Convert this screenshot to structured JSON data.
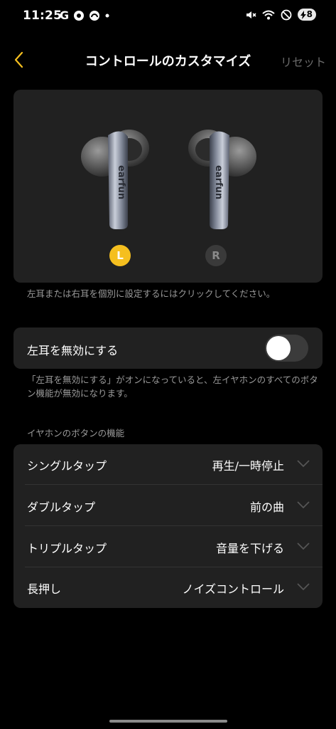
{
  "status": {
    "time": "11:25",
    "left_icons": [
      "G"
    ],
    "battery": "8"
  },
  "header": {
    "title": "コントロールのカスタマイズ",
    "reset": "リセット"
  },
  "earbuds": {
    "left_badge": "L",
    "right_badge": "R",
    "selected": "L",
    "case_text_left": "earfun",
    "case_text_right": "earfun",
    "hint": "左耳または右耳を個別に設定するにはクリックしてください。"
  },
  "disable_left": {
    "label": "左耳を無効にする",
    "enabled": false,
    "note": "「左耳を無効にする」がオンになっていると、左イヤホンのすべてのボタン機能が無効になります。"
  },
  "functions": {
    "section_title": "イヤホンのボタンの機能",
    "rows": [
      {
        "label": "シングルタップ",
        "value": "再生/一時停止"
      },
      {
        "label": "ダブルタップ",
        "value": "前の曲"
      },
      {
        "label": "トリプルタップ",
        "value": "音量を下げる"
      },
      {
        "label": "長押し",
        "value": "ノイズコントロール"
      }
    ]
  },
  "colors": {
    "accent": "#f5bf1f",
    "card": "#212121",
    "background": "#000000"
  }
}
